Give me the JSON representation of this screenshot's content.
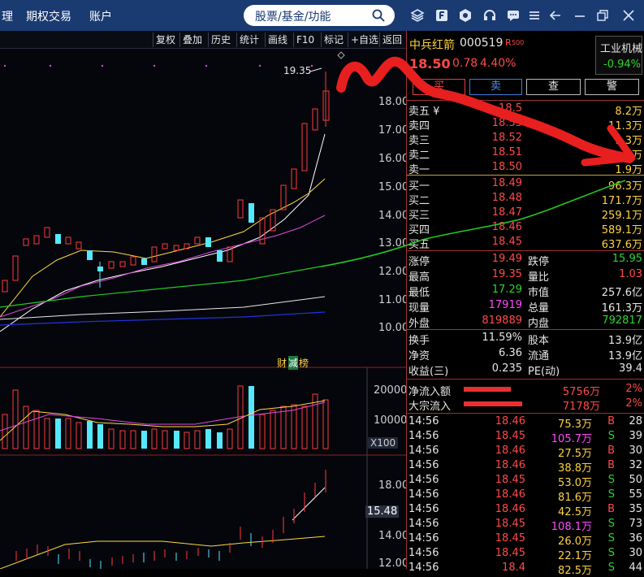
{
  "topbar": {
    "menu": [
      "理",
      "期权交易",
      "账户"
    ],
    "search_placeholder": "股票/基金/功能",
    "icons": [
      "layers-icon",
      "f-icon",
      "hexagon-icon",
      "headset-icon",
      "message-icon",
      "menu-icon",
      "back-icon",
      "minimize-icon",
      "restore-icon",
      "close-icon"
    ]
  },
  "toolbar": {
    "buttons": [
      "复权",
      "叠加",
      "历史",
      "统计",
      "画线",
      "F10",
      "标记",
      "+自选",
      "返回"
    ]
  },
  "kline": {
    "peak_label": "19.35",
    "price_axis": [
      "18.00",
      "17.00",
      "16.00",
      "15.00",
      "14.00",
      "13.00",
      "12.00",
      "11.00",
      "10.00"
    ],
    "badge_cai": "财",
    "badge_jian": "减",
    "badge_bang": "榜"
  },
  "volume": {
    "axis": [
      "20000",
      "10000"
    ],
    "unit": "X100"
  },
  "lower_chart": {
    "axis": [
      "18.00",
      "14.00",
      "12.00"
    ],
    "cursor_value": "15.48"
  },
  "stock": {
    "name": "中兵红箭",
    "code": "000519",
    "tag": "R",
    "tag_sub": "500",
    "price": "18.50",
    "change": "0.78",
    "change_pct": "4.40%",
    "industry": "工业机械",
    "industry_change": "-0.94%",
    "actions": [
      "买",
      "卖",
      "查",
      "警"
    ]
  },
  "sell_orders": [
    {
      "label": "卖五 ¥",
      "price": "18.5",
      "volume": "8.2万"
    },
    {
      "label": "卖四",
      "price": "18.53",
      "volume": "11.3万"
    },
    {
      "label": "卖三",
      "price": "18.52",
      "volume": "9.3万"
    },
    {
      "label": "卖二",
      "price": "18.51",
      "volume": "4万"
    },
    {
      "label": "卖一",
      "price": "18.50",
      "volume": "1.9万"
    }
  ],
  "buy_orders": [
    {
      "label": "买一",
      "price": "18.49",
      "volume": "96.3万"
    },
    {
      "label": "买二",
      "price": "18.48",
      "volume": "171.7万"
    },
    {
      "label": "买三",
      "price": "18.47",
      "volume": "259.1万"
    },
    {
      "label": "买四",
      "price": "18.46",
      "volume": "589.1万"
    },
    {
      "label": "买五",
      "price": "18.45",
      "volume": "637.6万"
    }
  ],
  "stats": [
    {
      "k1": "涨停",
      "v1": "19.49",
      "c1": "red",
      "k2": "跌停",
      "v2": "15.95",
      "c2": "green"
    },
    {
      "k1": "最高",
      "v1": "19.35",
      "c1": "red",
      "k2": "量比",
      "v2": "1.03",
      "c2": "red"
    },
    {
      "k1": "最低",
      "v1": "17.29",
      "c1": "green",
      "k2": "市值",
      "v2": "257.6亿",
      "c2": "white"
    },
    {
      "k1": "现量",
      "v1": "17919",
      "c1": "magenta",
      "k2": "总量",
      "v2": "161.3万",
      "c2": "white"
    },
    {
      "k1": "外盘",
      "v1": "819889",
      "c1": "red",
      "k2": "内盘",
      "v2": "792817",
      "c2": "green"
    }
  ],
  "stats2": [
    {
      "k1": "换手",
      "v1": "11.59%",
      "k2": "股本",
      "v2": "13.9亿"
    },
    {
      "k1": "净资",
      "v1": "6.36",
      "k2": "流通",
      "v2": "13.9亿"
    },
    {
      "k1": "收益(三)",
      "v1": "0.235",
      "k2": "PE(动)",
      "v2": "39.4"
    }
  ],
  "flows": [
    {
      "label": "净流入额",
      "value": "5756万",
      "pct": "2%"
    },
    {
      "label": "大宗流入",
      "value": "7178万",
      "pct": "2%"
    }
  ],
  "ticks": [
    {
      "time": "14:56",
      "price": "18.46",
      "vol": "75.3万",
      "side": "B",
      "n": "28"
    },
    {
      "time": "14:56",
      "price": "18.45",
      "vol": "105.7万",
      "side": "S",
      "n": "39"
    },
    {
      "time": "14:56",
      "price": "18.46",
      "vol": "27.5万",
      "side": "B",
      "n": "30"
    },
    {
      "time": "14:56",
      "price": "18.46",
      "vol": "38.8万",
      "side": "B",
      "n": "32"
    },
    {
      "time": "14:56",
      "price": "18.45",
      "vol": "53.0万",
      "side": "S",
      "n": "50"
    },
    {
      "time": "14:56",
      "price": "18.46",
      "vol": "81.6万",
      "side": "S",
      "n": "55"
    },
    {
      "time": "14:56",
      "price": "18.46",
      "vol": "42.5万",
      "side": "B",
      "n": "35"
    },
    {
      "time": "14:56",
      "price": "18.45",
      "vol": "108.1万",
      "side": "S",
      "n": "73"
    },
    {
      "time": "14:56",
      "price": "18.45",
      "vol": "26.0万",
      "side": "S",
      "n": "36"
    },
    {
      "time": "14:56",
      "price": "18.45",
      "vol": "22.1万",
      "side": "S",
      "n": "30"
    },
    {
      "time": "14:56",
      "price": "18.4",
      "vol": "82.5万",
      "side": "S",
      "n": "44"
    }
  ]
}
